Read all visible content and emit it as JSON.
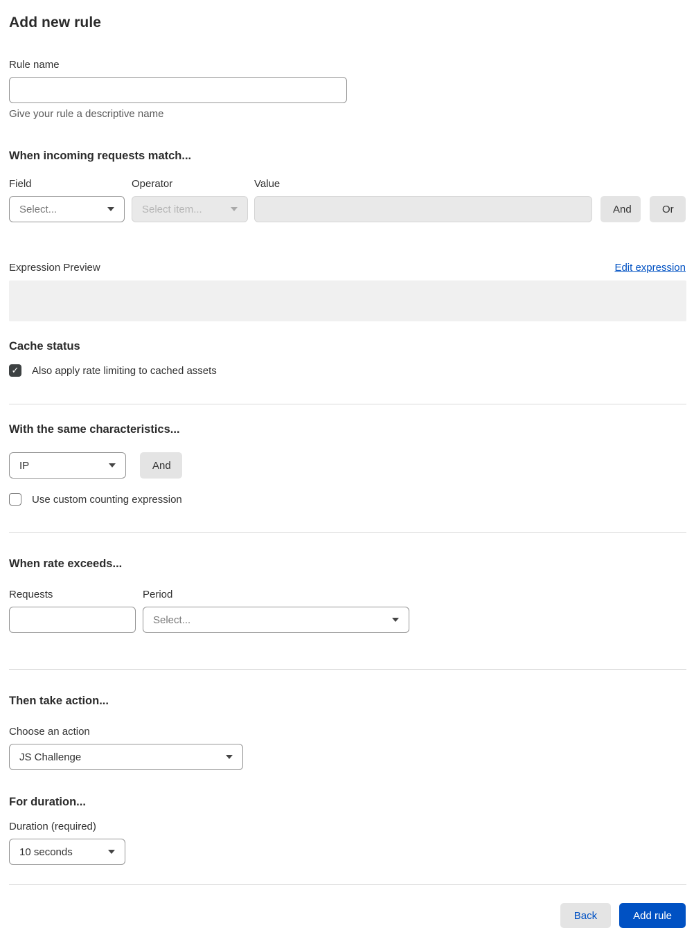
{
  "page": {
    "title": "Add new rule"
  },
  "colors": {
    "accent_blue": "#0051c3",
    "checkbox_checked": "#3d4142",
    "disabled_bg": "#e9e9e9",
    "divider": "#d9d9d9"
  },
  "rule_name": {
    "label": "Rule name",
    "value": "",
    "helper": "Give your rule a descriptive name"
  },
  "match_section": {
    "heading": "When incoming requests match...",
    "field": {
      "label": "Field",
      "selected": "Select...",
      "enabled": true
    },
    "operator": {
      "label": "Operator",
      "selected": "Select item...",
      "enabled": false
    },
    "value": {
      "label": "Value",
      "value": "",
      "enabled": false
    },
    "and_button": "And",
    "or_button": "Or",
    "expression_preview": {
      "label": "Expression Preview",
      "edit_link": "Edit expression",
      "content": ""
    }
  },
  "cache_status": {
    "heading": "Cache status",
    "checkbox_label": "Also apply rate limiting to cached assets",
    "checked": true,
    "checkmark": "✓"
  },
  "characteristics": {
    "heading": "With the same characteristics...",
    "select_value": "IP",
    "and_button": "And",
    "checkbox_label": "Use custom counting expression",
    "checked": false
  },
  "rate_section": {
    "heading": "When rate exceeds...",
    "requests": {
      "label": "Requests",
      "value": ""
    },
    "period": {
      "label": "Period",
      "selected": "Select..."
    }
  },
  "action_section": {
    "heading": "Then take action...",
    "label": "Choose an action",
    "selected": "JS Challenge"
  },
  "duration_section": {
    "heading": "For duration...",
    "label": "Duration (required)",
    "selected": "10 seconds"
  },
  "footer": {
    "back_label": "Back",
    "add_rule_label": "Add rule"
  }
}
